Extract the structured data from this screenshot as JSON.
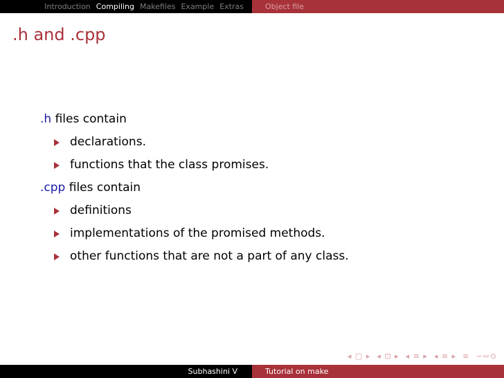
{
  "header": {
    "sections": [
      "Introduction",
      "Compiling",
      "Makefiles",
      "Example",
      "Extras"
    ],
    "active_section": "Compiling",
    "subsection": "Object file"
  },
  "slide": {
    "title": ".h and .cpp",
    "h_code": ".h",
    "h_text": " files contain",
    "h_items": [
      "declarations.",
      "functions that the class promises."
    ],
    "cpp_code": ".cpp",
    "cpp_text": " files contain",
    "cpp_items": [
      "definitions",
      "implementations of the promised methods.",
      "other functions that are not a part of any class."
    ]
  },
  "nav_symbols": [
    "◂ ▢ ▸",
    "◂ ⊡ ▸",
    "◂ ≡ ▸",
    "◂ ≡ ▸",
    "≡",
    "∽∾⊙"
  ],
  "footer": {
    "author": "Subhashini V",
    "short_title": "Tutorial on make"
  },
  "colors": {
    "accent": "#a8323a",
    "code": "#1a1aa8",
    "bar": "#000000"
  }
}
